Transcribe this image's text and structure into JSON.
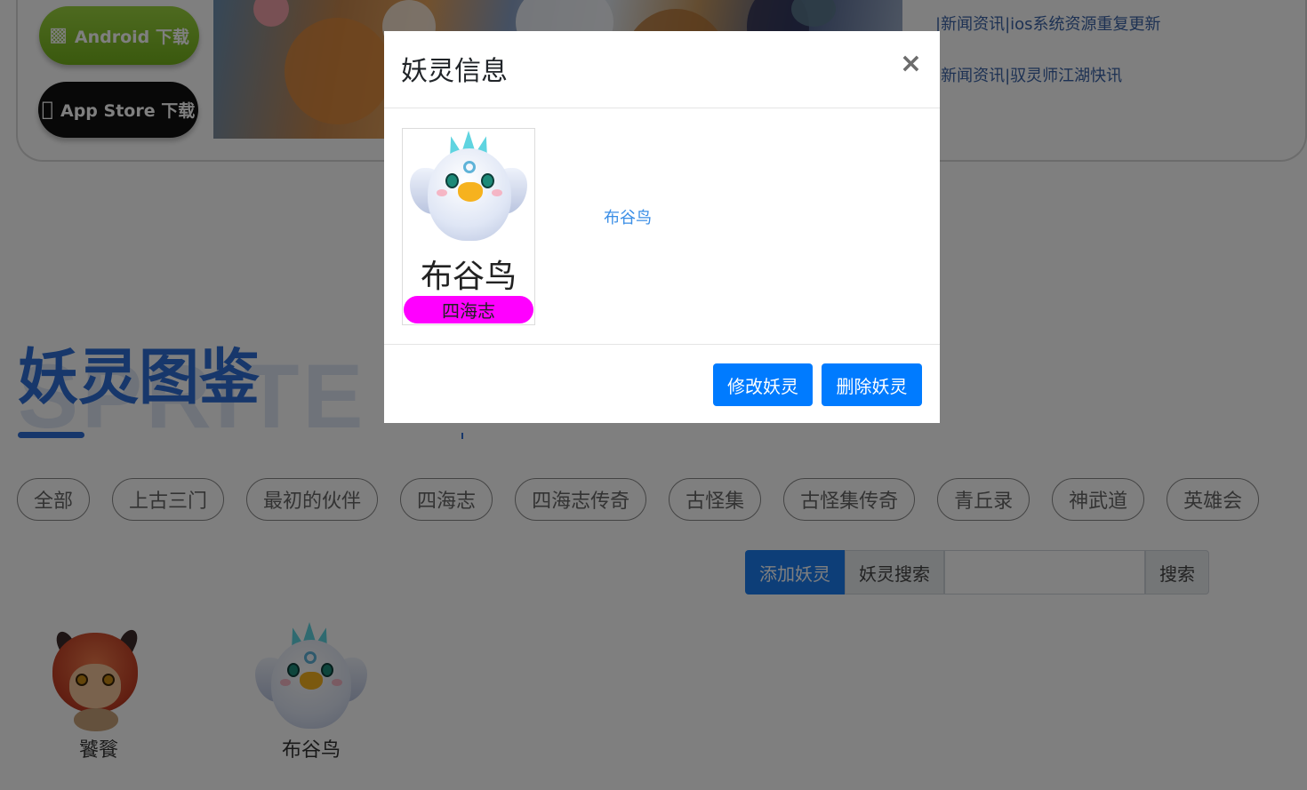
{
  "downloads": {
    "android": {
      "label": "Android 下载",
      "icon": "android-icon"
    },
    "appstore": {
      "label": "App Store 下载",
      "icon": "apple-icon"
    }
  },
  "news": [
    "|新闻资讯|ios系统资源重复更新",
    "|新闻资讯|驭灵师江湖快讯"
  ],
  "section": {
    "title": "妖灵图鉴",
    "bg_title": "SPRITE"
  },
  "categories": [
    "全部",
    "上古三门",
    "最初的伙伴",
    "四海志",
    "四海志传奇",
    "古怪集",
    "古怪集传奇",
    "青丘录",
    "神武道",
    "英雄会"
  ],
  "toolbar": {
    "add_label": "添加妖灵",
    "search_label": "妖灵搜索",
    "search_value": "",
    "search_button": "搜索"
  },
  "grid": [
    {
      "name": "饕餮"
    },
    {
      "name": "布谷鸟"
    }
  ],
  "modal": {
    "title": "妖灵信息",
    "close": "×",
    "card_name": "布谷鸟",
    "card_tag": "四海志",
    "card_tag_color": "#ff00ff",
    "link": "布谷鸟",
    "edit_button": "修改妖灵",
    "delete_button": "删除妖灵"
  },
  "colors": {
    "primary": "#007bff",
    "accent_blue": "#2f6fd6"
  }
}
